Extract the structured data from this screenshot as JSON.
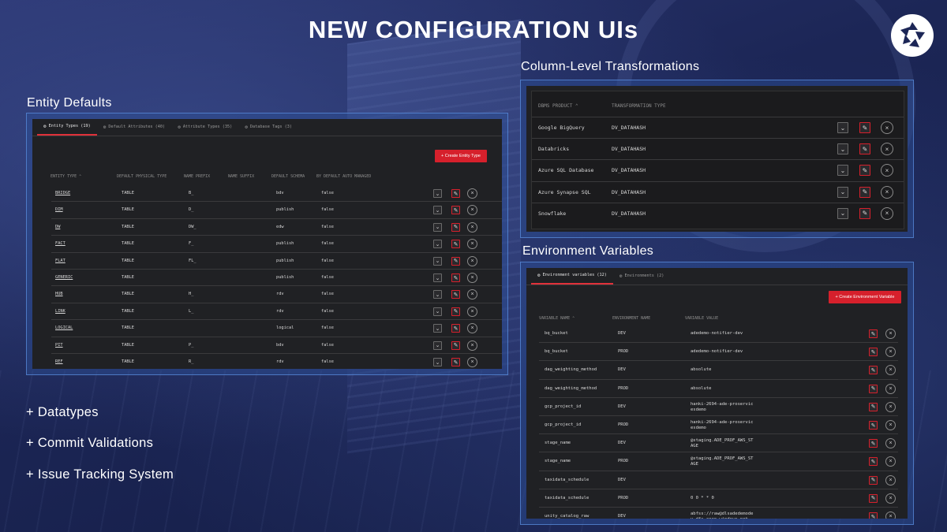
{
  "title": "NEW CONFIGURATION UIs",
  "logo_icon": "aperture-logo-icon",
  "sections": {
    "entity_defaults": "Entity Defaults",
    "column_level": "Column-Level Transformations",
    "env_vars": "Environment Variables"
  },
  "bullets": [
    "+ Datatypes",
    "+ Commit Validations",
    "+ Issue Tracking System"
  ],
  "colors": {
    "accent": "#d6202c",
    "panel": "#202124",
    "frame": "#2d5096"
  },
  "entity": {
    "tabs": [
      "Entity Types (19)",
      "Default Attributes (40)",
      "Attribute Types (35)",
      "Database Tags (3)"
    ],
    "create_label": "+  Create Entity Type",
    "columns": [
      "ENTITY TYPE ⌃",
      "DEFAULT PHYSICAL TYPE",
      "NAME PREFIX",
      "NAME SUFFIX",
      "DEFAULT SCHEMA",
      "BY DEFAULT AUTO MANAGED"
    ],
    "rows": [
      [
        "BRIDGE",
        "TABLE",
        "B_",
        "",
        "bdv",
        "false"
      ],
      [
        "DIM",
        "TABLE",
        "D_",
        "",
        "publish",
        "false"
      ],
      [
        "DW",
        "TABLE",
        "DW_",
        "",
        "edw",
        "false"
      ],
      [
        "FACT",
        "TABLE",
        "F_",
        "",
        "publish",
        "false"
      ],
      [
        "FLAT",
        "TABLE",
        "FL_",
        "",
        "publish",
        "false"
      ],
      [
        "GENERIC",
        "TABLE",
        "",
        "",
        "publish",
        "false"
      ],
      [
        "HUB",
        "TABLE",
        "H_",
        "",
        "rdv",
        "false"
      ],
      [
        "LINK",
        "TABLE",
        "L_",
        "",
        "rdv",
        "false"
      ],
      [
        "LOGICAL",
        "TABLE",
        "",
        "",
        "logical",
        "false"
      ],
      [
        "PIT",
        "TABLE",
        "P_",
        "",
        "bdv",
        "false"
      ],
      [
        "REF",
        "TABLE",
        "R_",
        "",
        "rdv",
        "false"
      ]
    ]
  },
  "transform": {
    "columns": [
      "DBMS PRODUCT ⌃",
      "TRANSFORMATION TYPE"
    ],
    "rows": [
      [
        "Google BigQuery",
        "DV_DATAHASH"
      ],
      [
        "Databricks",
        "DV_DATAHASH"
      ],
      [
        "Azure SQL Database",
        "DV_DATAHASH"
      ],
      [
        "Azure Synapse SQL",
        "DV_DATAHASH"
      ],
      [
        "Snowflake",
        "DV_DATAHASH"
      ]
    ]
  },
  "env": {
    "tabs": [
      "Environment variables (12)",
      "Environments (2)"
    ],
    "create_label": "+  Create Environment Variable",
    "columns": [
      "VARIABLE NAME ⌃",
      "ENVIRONMENT NAME",
      "VARIABLE VALUE"
    ],
    "rows": [
      [
        "bq_bucket",
        "DEV",
        "adedemo-notifier-dev",
        ""
      ],
      [
        "bq_bucket",
        "PROD",
        "adedemo-notifier-dev",
        ""
      ],
      [
        "dag_weighting_method",
        "DEV",
        "absolute",
        ""
      ],
      [
        "dag_weighting_method",
        "PROD",
        "absolute",
        ""
      ],
      [
        "gcp_project_id",
        "DEV",
        "hanki-2694-ade-proservic",
        "esdemo"
      ],
      [
        "gcp_project_id",
        "PROD",
        "hanki-2694-ade-proservic",
        "esdemo"
      ],
      [
        "stage_name",
        "DEV",
        "@staging.ADE_PROF_AWS_ST",
        "AGE"
      ],
      [
        "stage_name",
        "PROD",
        "@staging.ADE_PROF_AWS_ST",
        "AGE"
      ],
      [
        "taxidata_schedule",
        "DEV",
        "",
        ""
      ],
      [
        "taxidata_schedule",
        "PROD",
        "0 0 * * 0",
        ""
      ],
      [
        "unity_catalog_raw",
        "DEV",
        "abfss://raw@dlsadedemode",
        "v.dfs.core.windows.net"
      ]
    ]
  }
}
